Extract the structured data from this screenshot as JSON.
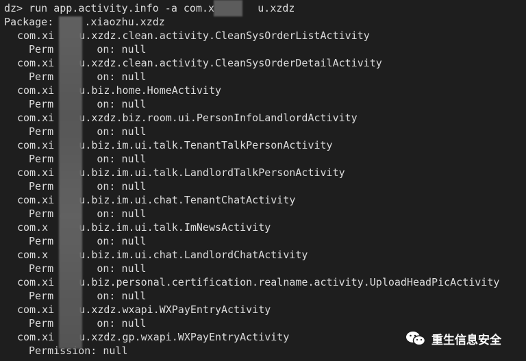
{
  "terminal": {
    "lines": [
      {
        "text": "dz> run app.activity.info -a com.x       u.xzdz"
      },
      {
        "text": "Package:     .xiaozhu.xzdz"
      },
      {
        "text": "com.xi    u.xzdz.clean.activity.CleanSysOrderListActivity"
      },
      {
        "text": "Perm       on: null"
      },
      {
        "text": "com.xi    u.xzdz.clean.activity.CleanSysOrderDetailActivity"
      },
      {
        "text": "Perm       on: null"
      },
      {
        "text": "com.xi    u.biz.home.HomeActivity"
      },
      {
        "text": "Perm       on: null"
      },
      {
        "text": "com.xi    u.xzdz.biz.room.ui.PersonInfoLandlordActivity"
      },
      {
        "text": "Perm       on: null"
      },
      {
        "text": "com.xi    u.biz.im.ui.talk.TenantTalkPersonActivity"
      },
      {
        "text": "Perm       on: null"
      },
      {
        "text": "com.xi    u.biz.im.ui.talk.LandlordTalkPersonActivity"
      },
      {
        "text": "Perm       on: null"
      },
      {
        "text": "com.xi    u.biz.im.ui.chat.TenantChatActivity"
      },
      {
        "text": "Perm       on: null"
      },
      {
        "text": "com.x     u.biz.im.ui.talk.ImNewsActivity"
      },
      {
        "text": "Perm       on: null"
      },
      {
        "text": "com.x     u.biz.im.ui.chat.LandlordChatActivity"
      },
      {
        "text": "Perm       on: null"
      },
      {
        "text": "com.xi    u.biz.personal.certification.realname.activity.UploadHeadPicActivity"
      },
      {
        "text": "Perm       on: null"
      },
      {
        "text": "com.xi    u.xzdz.wxapi.WXPayEntryActivity"
      },
      {
        "text": "Perm       on: null"
      },
      {
        "text": "com.xi    u.xzdz.gp.wxapi.WXPayEntryActivity"
      },
      {
        "text": "Permission: null"
      }
    ]
  },
  "watermark": {
    "text": "重生信息安全",
    "icon": "wechat-icon"
  },
  "colors": {
    "background": "#1e1e1e",
    "text": "#dcdcdc",
    "watermark": "#ffffff"
  }
}
